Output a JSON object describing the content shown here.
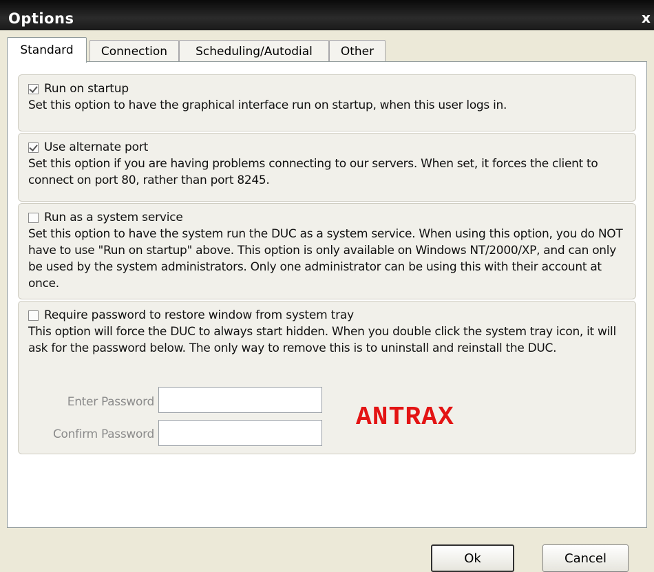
{
  "window": {
    "title": "Options",
    "close_glyph": "x"
  },
  "tabs": [
    {
      "label": "Standard",
      "active": true
    },
    {
      "label": "Connection",
      "active": false
    },
    {
      "label": "Scheduling/Autodial",
      "active": false
    },
    {
      "label": "Other",
      "active": false
    }
  ],
  "options": [
    {
      "label": "Run on startup",
      "checked": true,
      "description": "Set this option to have the graphical interface run on startup, when this user logs in."
    },
    {
      "label": "Use alternate port",
      "checked": true,
      "description": "Set this option if you are having problems connecting to our servers.  When set, it forces the client to connect on port 80, rather than port 8245."
    },
    {
      "label": "Run as a system service",
      "checked": false,
      "description": "Set this option to have the system run the DUC as a system service.  When using this option, you do NOT have to use \"Run on startup\" above.  This option is only available on Windows NT/2000/XP, and can only be used by the system administrators.  Only one administrator can be using this with their account at once."
    },
    {
      "label": "Require password to restore window from system tray",
      "checked": false,
      "description": "This option will force the DUC to always start hidden.  When you double click the system tray icon, it will ask for the password below.  The only way to remove this is to uninstall and reinstall the DUC."
    }
  ],
  "password": {
    "enter_label": "Enter Password",
    "enter_value": "",
    "confirm_label": "Confirm Password",
    "confirm_value": ""
  },
  "watermark": "ANTRAX",
  "buttons": {
    "ok": "Ok",
    "cancel": "Cancel"
  },
  "colors": {
    "watermark": "#e31414",
    "titlebar": "#1a1a1a"
  }
}
